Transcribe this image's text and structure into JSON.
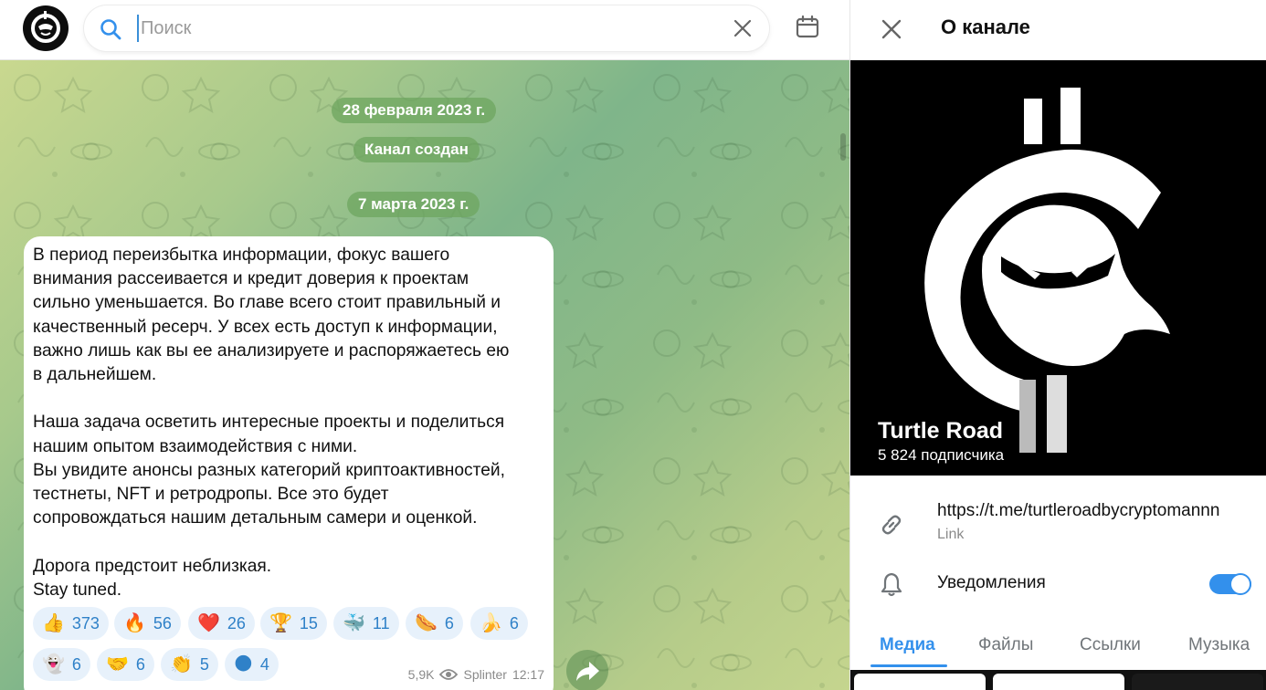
{
  "search": {
    "placeholder": "Поиск"
  },
  "chat": {
    "date1": "28 февраля 2023 г.",
    "service": "Канал создан",
    "date2": "7 марта 2023 г.",
    "message": {
      "text": "В период переизбытка информации, фокус вашего\nвнимания рассеивается и кредит доверия к проектам\nсильно уменьшается. Во главе всего стоит правильный и\nкачественный ресерч. У всех есть доступ к информации,\nважно лишь как вы ее анализируете и распоряжаетесь ею\nв дальнейшем.\n\nНаша задача осветить интересные проекты и поделиться\nнашим опытом взаимодействия с ними.\nВы увидите анонсы разных категорий криптоактивностей,\nтестнеты, NFT и ретродропы. Все это будет\nсопровождаться нашим детальным самери и оценкой.\n\nДорога предстоит неблизкая.\nStay tuned.",
      "reactions": [
        {
          "emoji": "👍",
          "count": "373"
        },
        {
          "emoji": "🔥",
          "count": "56"
        },
        {
          "emoji": "❤️",
          "count": "26"
        },
        {
          "emoji": "🏆",
          "count": "15"
        },
        {
          "emoji": "🐳",
          "count": "11"
        },
        {
          "emoji": "🌭",
          "count": "6"
        },
        {
          "emoji": "🍌",
          "count": "6"
        },
        {
          "emoji": "👻",
          "count": "6"
        },
        {
          "emoji": "🤝",
          "count": "6"
        },
        {
          "emoji": "👏",
          "count": "5"
        },
        {
          "emoji": "🌑",
          "count": "4"
        }
      ],
      "views": "5,9K",
      "author": "Splinter",
      "time": "12:17"
    }
  },
  "panel": {
    "title": "О канале",
    "channel_name": "Turtle Road",
    "subscribers": "5 824 подписчика",
    "link": "https://t.me/turtleroadbycryptomannn",
    "link_label": "Link",
    "notifications_label": "Уведомления",
    "notifications_on": true,
    "tabs": [
      "Медиа",
      "Файлы",
      "Ссылки",
      "Музыка"
    ],
    "active_tab": "Медиа"
  },
  "colors": {
    "accent": "#3390ec",
    "reaction_bg": "#e7f1fb",
    "pill_bg": "#6ea55f"
  }
}
